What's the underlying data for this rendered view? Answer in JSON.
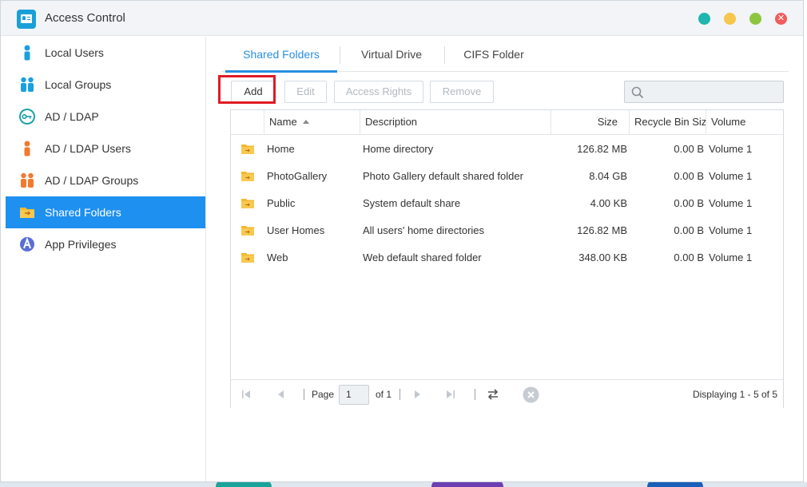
{
  "window": {
    "title": "Access Control",
    "controls": [
      "minimize",
      "restore",
      "maximize",
      "close"
    ],
    "control_colors": [
      "#1fb5b0",
      "#f7c64a",
      "#8cc63f",
      "#f25c5c"
    ]
  },
  "sidebar": {
    "items": [
      {
        "label": "Local Users",
        "icon": "person-icon",
        "active": false
      },
      {
        "label": "Local Groups",
        "icon": "people-icon",
        "active": false
      },
      {
        "label": "AD / LDAP",
        "icon": "key-icon",
        "active": false
      },
      {
        "label": "AD / LDAP Users",
        "icon": "person-icon",
        "active": false
      },
      {
        "label": "AD / LDAP Groups",
        "icon": "people-icon",
        "active": false
      },
      {
        "label": "Shared Folders",
        "icon": "shared-folder-icon",
        "active": true
      },
      {
        "label": "App Privileges",
        "icon": "app-icon",
        "active": false
      }
    ]
  },
  "tabs": [
    {
      "label": "Shared Folders",
      "active": true
    },
    {
      "label": "Virtual Drive",
      "active": false
    },
    {
      "label": "CIFS Folder",
      "active": false
    }
  ],
  "toolbar": {
    "add": "Add",
    "edit": "Edit",
    "access_rights": "Access Rights",
    "remove": "Remove",
    "search_placeholder": ""
  },
  "grid": {
    "columns": [
      "Name",
      "Description",
      "Size",
      "Recycle Bin Size",
      "Volume"
    ],
    "rows": [
      {
        "name": "Home",
        "description": "Home directory",
        "size": "126.82 MB",
        "recycle": "0.00 B",
        "volume": "Volume 1"
      },
      {
        "name": "PhotoGallery",
        "description": "Photo Gallery default shared folder",
        "size": "8.04 GB",
        "recycle": "0.00 B",
        "volume": "Volume 1"
      },
      {
        "name": "Public",
        "description": "System default share",
        "size": "4.00 KB",
        "recycle": "0.00 B",
        "volume": "Volume 1"
      },
      {
        "name": "User Homes",
        "description": "All users' home directories",
        "size": "126.82 MB",
        "recycle": "0.00 B",
        "volume": "Volume 1"
      },
      {
        "name": "Web",
        "description": "Web default shared folder",
        "size": "348.00 KB",
        "recycle": "0.00 B",
        "volume": "Volume 1"
      }
    ]
  },
  "pager": {
    "page_label": "Page",
    "page_value": "1",
    "of_label": "of 1",
    "display_text": "Displaying 1 - 5 of 5"
  },
  "colors": {
    "accent": "#1e90f0",
    "tab_accent": "#2a8fe0",
    "highlight": "#e01b24",
    "folder": "#f5b731"
  }
}
